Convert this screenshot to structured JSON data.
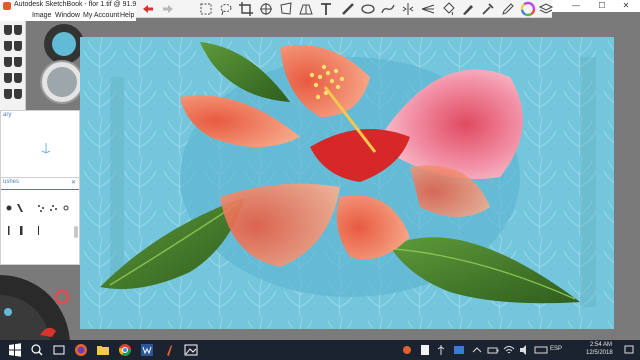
{
  "window": {
    "title": "Autodesk SketchBook - flor 1.tif @ 91.9%",
    "minimize_glyph": "—",
    "maximize_glyph": "☐",
    "close_glyph": "✕"
  },
  "menu": {
    "items": [
      {
        "label": "Image"
      },
      {
        "label": "Window"
      },
      {
        "label": "My Account"
      },
      {
        "label": "Help"
      }
    ]
  },
  "toolbar": {
    "icons": [
      "undo-icon",
      "redo-icon",
      "select-icon",
      "lasso-icon",
      "crop-icon",
      "transform-icon",
      "distort-icon",
      "text-icon",
      "ruler-icon",
      "ellipse-icon",
      "french-curve-icon",
      "symmetry-icon",
      "perspective-icon",
      "fill-icon",
      "brush-icon",
      "eyedropper-icon",
      "color-wheel-icon",
      "layers-icon"
    ],
    "accent_color": "#d9342b"
  },
  "panels": {
    "library_title": "ary",
    "brushes_title": "ushes",
    "brushes_close_glyph": "✕"
  },
  "taskbar": {
    "language": "ESP",
    "time": "2:54 AM",
    "date": "12/5/2018"
  },
  "colors": {
    "canvas_background": "#74c6dc",
    "current_color": "#62bbd6",
    "flower_pink": "#f08aa0",
    "flower_red": "#d62828",
    "leaf_green": "#3f7a2a"
  }
}
